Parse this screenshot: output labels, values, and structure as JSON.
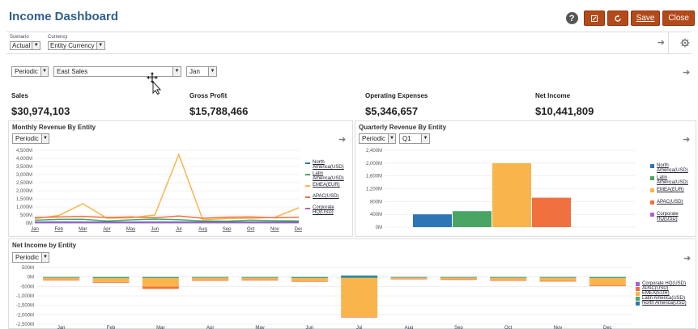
{
  "header": {
    "title": "Income Dashboard",
    "help_icon": "?",
    "save_label": "Save",
    "close_label": "Close"
  },
  "pov": {
    "scenario_label": "Scenario",
    "scenario_value": "Actual",
    "currency_label": "Currency",
    "currency_value": "Entity Currency"
  },
  "filters": {
    "view": "Periodic",
    "entity": "East Sales",
    "period": "Jan"
  },
  "kpis": [
    {
      "label": "Sales",
      "value": "$30,974,103"
    },
    {
      "label": "Gross Profit",
      "value": "$15,788,466"
    },
    {
      "label": "Operating Expenses",
      "value": "$5,346,657"
    },
    {
      "label": "Net Income",
      "value": "$10,441,809"
    }
  ],
  "monthly": {
    "title": "Monthly Revenue By Entity",
    "view": "Periodic"
  },
  "quarterly": {
    "title": "Quarterly Revenue By Entity",
    "view": "Periodic",
    "quarter": "Q1"
  },
  "netincome": {
    "title": "Net Income by Entity",
    "view": "Periodic"
  },
  "colors": {
    "north": "#2e75b6",
    "latin": "#4aa564",
    "emea": "#f9b54c",
    "apac": "#f07040",
    "corp": "#b35fc7"
  },
  "chart_data": [
    {
      "type": "line",
      "categories": [
        "Jan",
        "Feb",
        "Mar",
        "Apr",
        "May",
        "Jun",
        "Jul",
        "Aug",
        "Sep",
        "Oct",
        "Nov",
        "Dec"
      ],
      "ylim": [
        0,
        4500
      ],
      "yticks": [
        "0M",
        "500M",
        "1,000M",
        "1,500M",
        "2,000M",
        "2,500M",
        "3,000M",
        "3,500M",
        "4,000M",
        "4,500M"
      ],
      "series": [
        {
          "name": "North America(USD)",
          "color": "#2e75b6",
          "values": [
            60,
            70,
            60,
            60,
            60,
            60,
            70,
            60,
            60,
            60,
            60,
            60
          ]
        },
        {
          "name": "Latin America(USD)",
          "color": "#4aa564",
          "values": [
            180,
            230,
            240,
            130,
            200,
            250,
            210,
            130,
            120,
            180,
            150,
            130
          ]
        },
        {
          "name": "EMEA(EUR)",
          "color": "#f9b54c",
          "values": [
            280,
            470,
            1200,
            300,
            330,
            500,
            4250,
            200,
            280,
            300,
            350,
            950
          ]
        },
        {
          "name": "APAC(USD)",
          "color": "#f07040",
          "values": [
            350,
            380,
            420,
            350,
            380,
            330,
            440,
            300,
            370,
            380,
            330,
            360
          ]
        },
        {
          "name": "Corporate HQ(USD)",
          "color": "#b35fc7",
          "values": [
            20,
            20,
            20,
            20,
            20,
            20,
            20,
            20,
            20,
            20,
            20,
            20
          ]
        }
      ]
    },
    {
      "type": "bar",
      "categories": [
        "Q1"
      ],
      "ylim": [
        0,
        2400
      ],
      "yticks": [
        "0M",
        "400M",
        "800M",
        "1,200M",
        "1,600M",
        "2,000M",
        "2,400M"
      ],
      "series": [
        {
          "name": "North America(USD)",
          "color": "#2e75b6",
          "values": [
            400
          ]
        },
        {
          "name": "Latin America(USD)",
          "color": "#4aa564",
          "values": [
            500
          ]
        },
        {
          "name": "EMEA(EUR)",
          "color": "#f9b54c",
          "values": [
            2000
          ]
        },
        {
          "name": "APAC(USD)",
          "color": "#f07040",
          "values": [
            920
          ]
        },
        {
          "name": "Corporate HQ(USD)",
          "color": "#b35fc7",
          "values": [
            0
          ]
        }
      ]
    },
    {
      "type": "bar",
      "stacked": true,
      "categories": [
        "Jan",
        "Feb",
        "Mar",
        "Apr",
        "May",
        "Jun",
        "Jul",
        "Aug",
        "Sep",
        "Oct",
        "Nov",
        "Dec"
      ],
      "ylim": [
        -2500,
        500
      ],
      "yticks": [
        "-2,500M",
        "-2,000M",
        "-1,500M",
        "-1,000M",
        "-500M",
        "0M",
        "500M"
      ],
      "series": [
        {
          "name": "North America(USD)",
          "color": "#2e75b6",
          "values": [
            -10,
            -10,
            -10,
            -10,
            -10,
            -10,
            80,
            -10,
            -10,
            -10,
            -10,
            -10
          ]
        },
        {
          "name": "Latin America(USD)",
          "color": "#4aa564",
          "values": [
            -40,
            -60,
            -50,
            -40,
            -40,
            -50,
            -60,
            -30,
            -30,
            -40,
            -40,
            -50
          ]
        },
        {
          "name": "EMEA(EUR)",
          "color": "#f9b54c",
          "values": [
            -100,
            -200,
            -450,
            -110,
            -90,
            -160,
            -2050,
            -50,
            -80,
            -120,
            -160,
            -380
          ]
        },
        {
          "name": "APAC(USD)",
          "color": "#f07040",
          "values": [
            -30,
            -30,
            -120,
            -40,
            -40,
            -20,
            -30,
            -20,
            -30,
            -30,
            -30,
            -40
          ]
        },
        {
          "name": "Corporate HQ(USD)",
          "color": "#b35fc7",
          "values": [
            0,
            0,
            0,
            0,
            0,
            0,
            0,
            0,
            0,
            0,
            0,
            0
          ]
        }
      ]
    }
  ]
}
